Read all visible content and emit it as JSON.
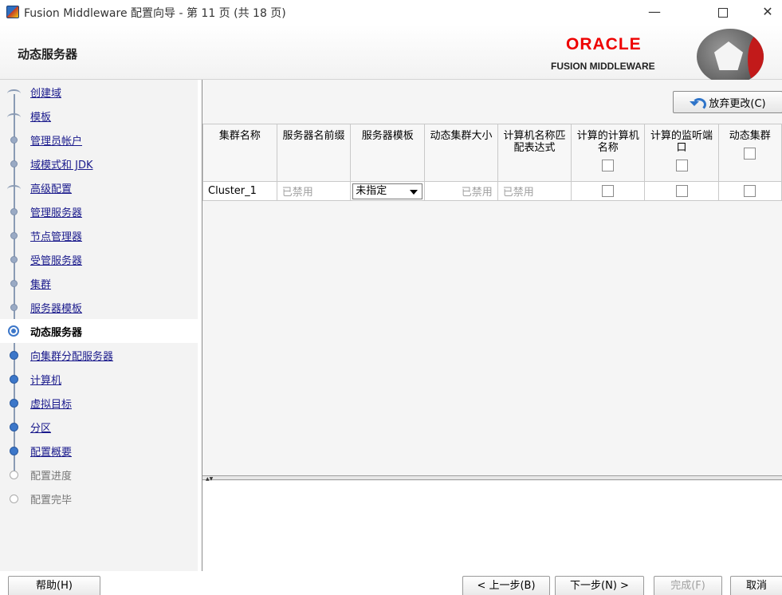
{
  "window": {
    "title": "Fusion Middleware 配置向导 - 第 11 页 (共 18 页)",
    "min_glyph": "—",
    "close_glyph": "✕"
  },
  "header": {
    "page_title": "动态服务器",
    "oracle_logo": "ORACLE",
    "fusion_middleware": "FUSION MIDDLEWARE"
  },
  "nav": {
    "items": [
      {
        "label": "创建域",
        "state": "done"
      },
      {
        "label": "模板",
        "state": "done"
      },
      {
        "label": "管理员帐户",
        "state": "done"
      },
      {
        "label": "域模式和 JDK",
        "state": "done"
      },
      {
        "label": "高级配置",
        "state": "done"
      },
      {
        "label": "管理服务器",
        "state": "done"
      },
      {
        "label": "节点管理器",
        "state": "done"
      },
      {
        "label": "受管服务器",
        "state": "done"
      },
      {
        "label": "集群",
        "state": "done"
      },
      {
        "label": "服务器模板",
        "state": "done"
      },
      {
        "label": "动态服务器",
        "state": "current"
      },
      {
        "label": "向集群分配服务器",
        "state": "next"
      },
      {
        "label": "计算机",
        "state": "next"
      },
      {
        "label": "虚拟目标",
        "state": "next"
      },
      {
        "label": "分区",
        "state": "next"
      },
      {
        "label": "配置概要",
        "state": "next"
      },
      {
        "label": "配置进度",
        "state": "pending"
      },
      {
        "label": "配置完毕",
        "state": "pending"
      }
    ]
  },
  "toolbar": {
    "discard_label": "放弃更改(C)"
  },
  "table": {
    "columns": [
      {
        "label": "集群名称",
        "has_checkbox": false
      },
      {
        "label": "服务器名前缀",
        "has_checkbox": false
      },
      {
        "label": "服务器模板",
        "has_checkbox": false
      },
      {
        "label": "动态集群大小",
        "has_checkbox": false
      },
      {
        "label": "计算机名称匹配表达式",
        "has_checkbox": false
      },
      {
        "label": "计算的计算机名称",
        "has_checkbox": true
      },
      {
        "label": "计算的监听端口",
        "has_checkbox": true
      },
      {
        "label": "动态集群",
        "has_checkbox": true
      }
    ],
    "rows": [
      {
        "cluster_name": "Cluster_1",
        "server_prefix": "已禁用",
        "server_template": "未指定",
        "cluster_size": "已禁用",
        "machine_expr": "已禁用",
        "calc_machine_checked": false,
        "calc_port_checked": false,
        "dynamic_checked": false
      }
    ]
  },
  "footer": {
    "help": "帮助(H)",
    "back": "< 上一步(B)",
    "next": "下一步(N) >",
    "finish": "完成(F)",
    "cancel": "取消"
  }
}
